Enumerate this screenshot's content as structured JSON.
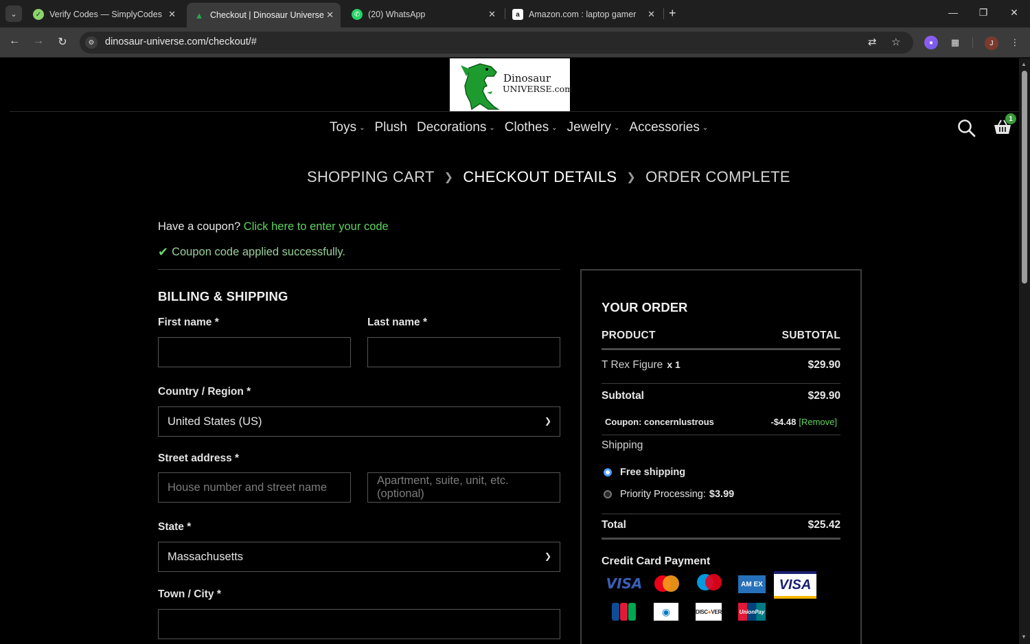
{
  "browser": {
    "tabs": [
      {
        "title": "Verify Codes — SimplyCodes",
        "favicon": "simplycodes-icon",
        "active": false
      },
      {
        "title": "Checkout | Dinosaur Universe",
        "favicon": "dinosaur-icon",
        "active": true
      },
      {
        "title": "(20) WhatsApp",
        "favicon": "whatsapp-icon",
        "active": false
      },
      {
        "title": "Amazon.com : laptop gamer",
        "favicon": "amazon-icon",
        "active": false
      }
    ],
    "url": "dinosaur-universe.com/checkout/#",
    "profile_initial": "J"
  },
  "site": {
    "logo_line1": "Dinosaur",
    "logo_line2": "UNIVERSE.com",
    "nav": [
      "Toys",
      "Plush",
      "Decorations",
      "Clothes",
      "Jewelry",
      "Accessories"
    ],
    "nav_has_dropdown": [
      true,
      false,
      true,
      true,
      true,
      true
    ],
    "cart_count": "1",
    "accent_color": "#5fd35f"
  },
  "breadcrumb": [
    "SHOPPING CART",
    "CHECKOUT DETAILS",
    "ORDER COMPLETE"
  ],
  "coupon": {
    "prompt": "Have a coupon?",
    "link": "Click here to enter your code",
    "success": "Coupon code applied successfully."
  },
  "billing": {
    "title": "BILLING & SHIPPING",
    "first_name_label": "First name",
    "last_name_label": "Last name",
    "country_label": "Country / Region",
    "country_value": "United States (US)",
    "street_label": "Street address",
    "street_placeholder": "House number and street name",
    "street2_placeholder": "Apartment, suite, unit, etc. (optional)",
    "state_label": "State",
    "state_value": "Massachusetts",
    "city_label": "Town / City",
    "required_mark": "*"
  },
  "order": {
    "title": "YOUR ORDER",
    "col_product": "PRODUCT",
    "col_subtotal": "SUBTOTAL",
    "item_name": "T Rex Figure",
    "item_qty": "x 1",
    "item_price": "$29.90",
    "subtotal_label": "Subtotal",
    "subtotal_value": "$29.90",
    "coupon_label": "Coupon: concernlustrous",
    "coupon_value": "-$4.48",
    "coupon_remove": "[Remove]",
    "shipping_label": "Shipping",
    "shipping_options": [
      {
        "label": "Free shipping",
        "price": "",
        "selected": true
      },
      {
        "label": "Priority Processing:",
        "price": "$3.99",
        "selected": false
      }
    ],
    "total_label": "Total",
    "total_value": "$25.42",
    "payment_title": "Credit Card Payment",
    "card_logos": [
      "visa",
      "mastercard",
      "maestro",
      "american-express",
      "visa-electron",
      "jcb",
      "diners-club",
      "discover",
      "unionpay"
    ]
  }
}
